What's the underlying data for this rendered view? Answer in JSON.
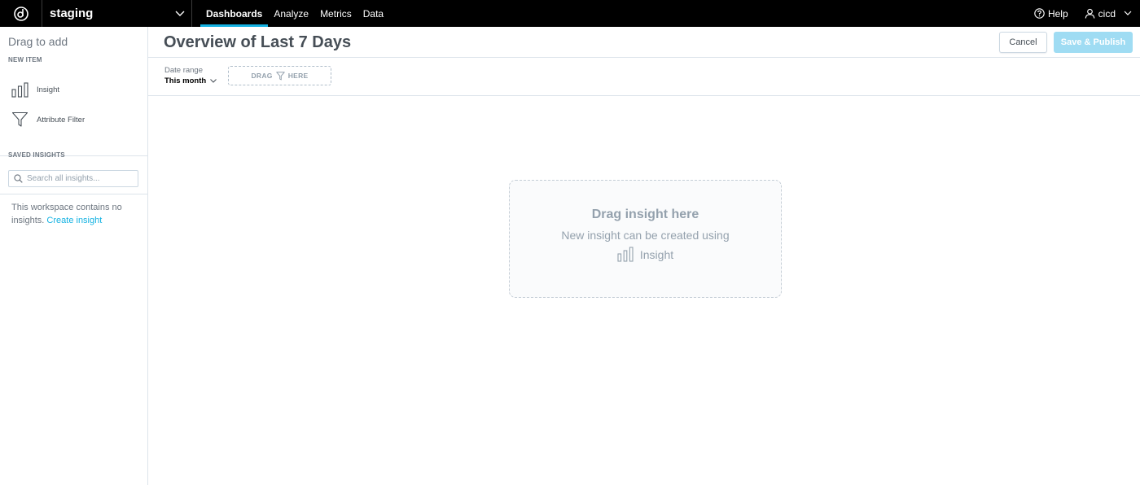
{
  "topbar": {
    "workspace": "staging",
    "nav": [
      "Dashboards",
      "Analyze",
      "Metrics",
      "Data"
    ],
    "active_nav": "Dashboards",
    "help": "Help",
    "user": "cicd",
    "accent_color": "#14b2e2"
  },
  "sidebar": {
    "title": "Drag to add",
    "new_item_label": "NEW ITEM",
    "items": [
      {
        "label": "Insight",
        "icon": "bar-chart-icon"
      },
      {
        "label": "Attribute Filter",
        "icon": "funnel-icon"
      }
    ],
    "saved_label": "SAVED INSIGHTS",
    "search_placeholder": "Search all insights...",
    "empty_text": "This workspace contains no insights.",
    "create_link": "Create insight"
  },
  "main": {
    "title": "Overview of Last 7 Days",
    "cancel": "Cancel",
    "publish": "Save & Publish",
    "date_range_label": "Date range",
    "date_range_value": "This month",
    "drag_filter_left": "DRAG",
    "drag_filter_right": "HERE",
    "drop_title": "Drag insight here",
    "drop_sub": "New insight can be created using",
    "drop_insight": "Insight"
  }
}
